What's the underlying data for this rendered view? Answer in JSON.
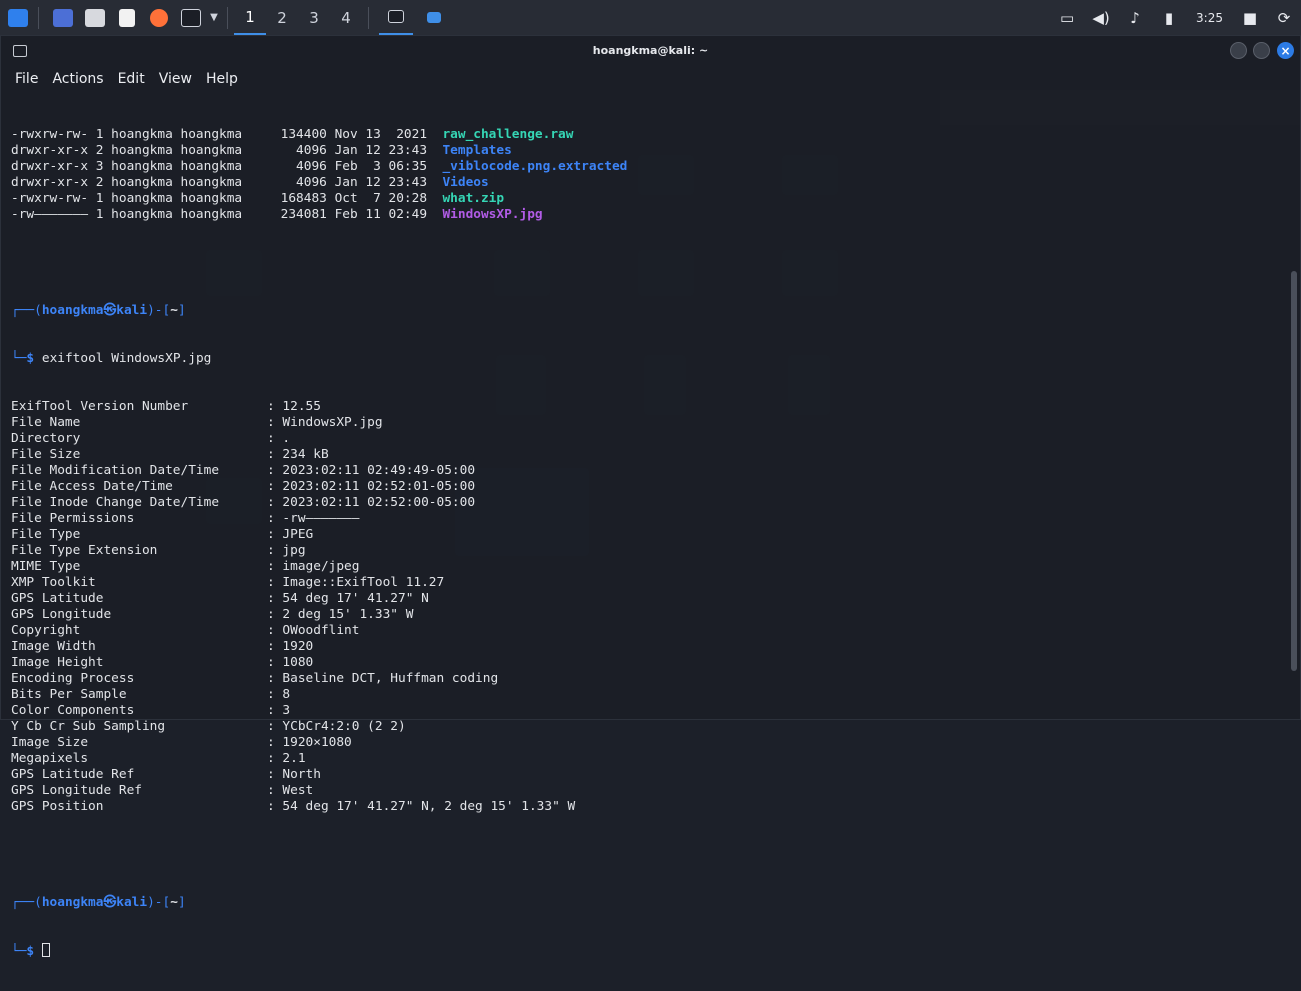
{
  "taskbar": {
    "apps": [
      {
        "name": "kali-menu-icon",
        "color": "#2f80ed"
      },
      {
        "name": "desktop-icon",
        "color": "#4c6fd6"
      },
      {
        "name": "file-manager-icon",
        "color": "#d7d9de"
      },
      {
        "name": "text-editor-icon",
        "color": "#f2f2f2"
      },
      {
        "name": "firefox-icon",
        "color": "#ff7139"
      },
      {
        "name": "terminal-icon",
        "color": "#1b1e26"
      }
    ],
    "workspaces": [
      "1",
      "2",
      "3",
      "4"
    ],
    "active_workspace": 0,
    "clock": "3:25"
  },
  "terminal": {
    "title": "hoangkma@kali: ~",
    "menu": [
      "File",
      "Actions",
      "Edit",
      "View",
      "Help"
    ],
    "listing": [
      {
        "perms": "-rwxrw-rw-",
        "links": "1",
        "owner": "hoangkma",
        "group": "hoangkma",
        "size": "134400",
        "date": "Nov 13  2021",
        "name": "raw_challenge.raw",
        "kind": "green"
      },
      {
        "perms": "drwxr-xr-x",
        "links": "2",
        "owner": "hoangkma",
        "group": "hoangkma",
        "size": "4096",
        "date": "Jan 12 23:43",
        "name": "Templates",
        "kind": "blue"
      },
      {
        "perms": "drwxr-xr-x",
        "links": "3",
        "owner": "hoangkma",
        "group": "hoangkma",
        "size": "4096",
        "date": "Feb  3 06:35",
        "name": "_viblocode.png.extracted",
        "kind": "blue"
      },
      {
        "perms": "drwxr-xr-x",
        "links": "2",
        "owner": "hoangkma",
        "group": "hoangkma",
        "size": "4096",
        "date": "Jan 12 23:43",
        "name": "Videos",
        "kind": "blue"
      },
      {
        "perms": "-rwxrw-rw-",
        "links": "1",
        "owner": "hoangkma",
        "group": "hoangkma",
        "size": "168483",
        "date": "Oct  7 20:28",
        "name": "what.zip",
        "kind": "green"
      },
      {
        "perms": "-rw———————",
        "links": "1",
        "owner": "hoangkma",
        "group": "hoangkma",
        "size": "234081",
        "date": "Feb 11 02:49",
        "name": "WindowsXP.jpg",
        "kind": "purple"
      }
    ],
    "prompt": {
      "user": "hoangkma",
      "at": "㉿",
      "host": "kali",
      "dir": "~",
      "sym": "$"
    },
    "command": "exiftool WindowsXP.jpg",
    "exif": [
      {
        "key": "ExifTool Version Number",
        "value": "12.55"
      },
      {
        "key": "File Name",
        "value": "WindowsXP.jpg"
      },
      {
        "key": "Directory",
        "value": "."
      },
      {
        "key": "File Size",
        "value": "234 kB"
      },
      {
        "key": "File Modification Date/Time",
        "value": "2023:02:11 02:49:49-05:00"
      },
      {
        "key": "File Access Date/Time",
        "value": "2023:02:11 02:52:01-05:00"
      },
      {
        "key": "File Inode Change Date/Time",
        "value": "2023:02:11 02:52:00-05:00"
      },
      {
        "key": "File Permissions",
        "value": "-rw———————"
      },
      {
        "key": "File Type",
        "value": "JPEG"
      },
      {
        "key": "File Type Extension",
        "value": "jpg"
      },
      {
        "key": "MIME Type",
        "value": "image/jpeg"
      },
      {
        "key": "XMP Toolkit",
        "value": "Image::ExifTool 11.27"
      },
      {
        "key": "GPS Latitude",
        "value": "54 deg 17' 41.27\" N"
      },
      {
        "key": "GPS Longitude",
        "value": "2 deg 15' 1.33\" W"
      },
      {
        "key": "Copyright",
        "value": "OWoodflint"
      },
      {
        "key": "Image Width",
        "value": "1920"
      },
      {
        "key": "Image Height",
        "value": "1080"
      },
      {
        "key": "Encoding Process",
        "value": "Baseline DCT, Huffman coding"
      },
      {
        "key": "Bits Per Sample",
        "value": "8"
      },
      {
        "key": "Color Components",
        "value": "3"
      },
      {
        "key": "Y Cb Cr Sub Sampling",
        "value": "YCbCr4:2:0 (2 2)"
      },
      {
        "key": "Image Size",
        "value": "1920×1080"
      },
      {
        "key": "Megapixels",
        "value": "2.1"
      },
      {
        "key": "GPS Latitude Ref",
        "value": "North"
      },
      {
        "key": "GPS Longitude Ref",
        "value": "West"
      },
      {
        "key": "GPS Position",
        "value": "54 deg 17' 41.27\" N, 2 deg 15' 1.33\" W"
      }
    ]
  }
}
